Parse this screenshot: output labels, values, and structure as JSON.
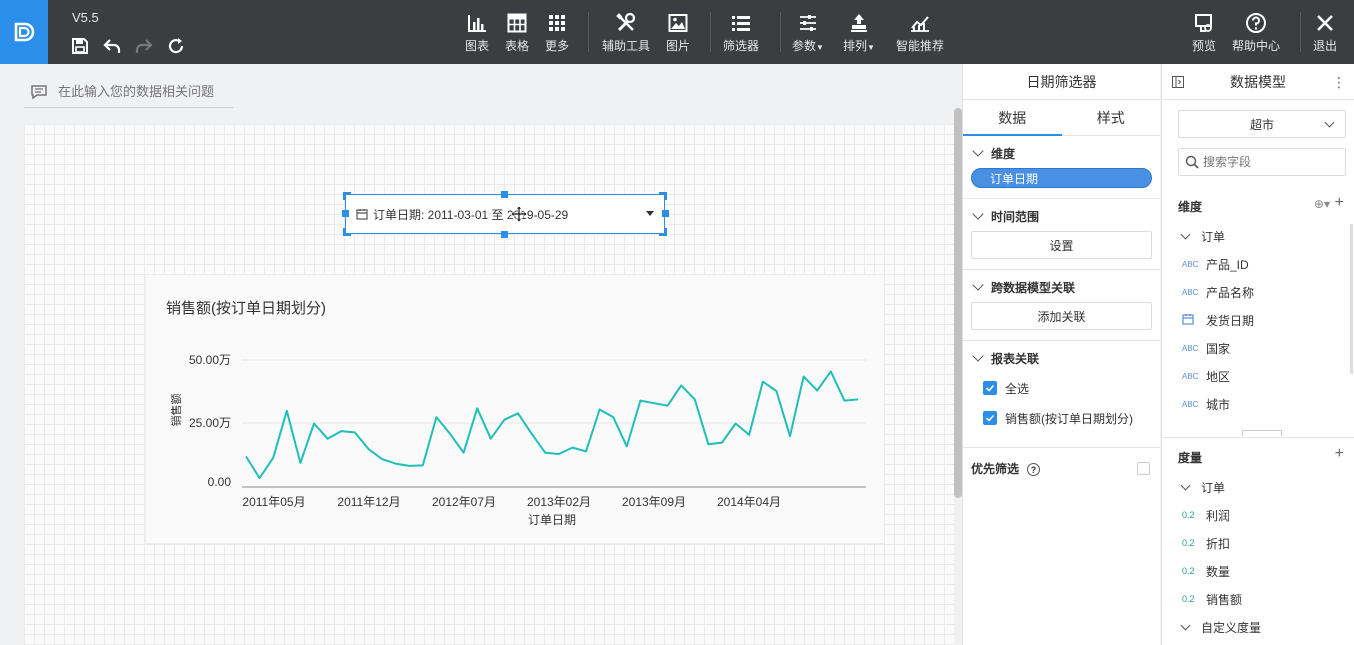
{
  "toolbar": {
    "version": "V5.5",
    "chart_label": "图表",
    "table_label": "表格",
    "more_label": "更多",
    "tools_label": "辅助工具",
    "image_label": "图片",
    "filter_label": "筛选器",
    "params_label": "参数",
    "sort_label": "排列",
    "recommend_label": "智能推荐",
    "preview_label": "预览",
    "help_label": "帮助中心",
    "exit_label": "退出"
  },
  "ask": {
    "placeholder": "在此输入您的数据相关问题"
  },
  "date_filter": {
    "text": "订单日期: 2011-03-01 至 2019-05-29"
  },
  "chart_data": {
    "type": "line",
    "title": "销售额(按订单日期划分)",
    "xlabel": "订单日期",
    "ylabel": "销售额",
    "ylim": [
      0,
      500000
    ],
    "yticks": [
      "0.00",
      "25.00万",
      "50.00万"
    ],
    "xticks": [
      "2011年05月",
      "2011年12月",
      "2012年07月",
      "2013年02月",
      "2013年09月",
      "2014年04月"
    ],
    "series": [
      {
        "values": [
          120000,
          35000,
          115000,
          300000,
          95000,
          250000,
          190000,
          220000,
          215000,
          150000,
          110000,
          92000,
          83000,
          85000,
          275000,
          210000,
          135000,
          310000,
          190000,
          265000,
          290000,
          210000,
          135000,
          130000,
          155000,
          140000,
          305000,
          275000,
          160000,
          340000,
          330000,
          320000,
          400000,
          345000,
          168000,
          175000,
          250000,
          205000,
          415000,
          378000,
          200000,
          435000,
          380000,
          455000,
          340000,
          345000
        ]
      }
    ],
    "grid": "horizontal",
    "color": "#1fbfb8"
  },
  "mid_panel": {
    "title": "日期筛选器",
    "tab_data": "数据",
    "tab_style": "样式",
    "dim_title": "维度",
    "dim_pill": "订单日期",
    "time_title": "时间范围",
    "time_btn": "设置",
    "cross_title": "跨数据模型关联",
    "cross_btn": "添加关联",
    "report_title": "报表关联",
    "select_all": "全选",
    "report_item": "销售额(按订单日期划分)",
    "priority": "优先筛选"
  },
  "right_panel": {
    "title": "数据模型",
    "model": "超市",
    "search_placeholder": "搜索字段",
    "dim_header": "维度",
    "dim_group": "订单",
    "dims": [
      "产品_ID",
      "产品名称",
      "发货日期",
      "国家",
      "地区",
      "城市"
    ],
    "measure_header": "度量",
    "measure_group": "订单",
    "measures": [
      "利润",
      "折扣",
      "数量",
      "销售额"
    ],
    "custom_group": "自定义度量"
  }
}
